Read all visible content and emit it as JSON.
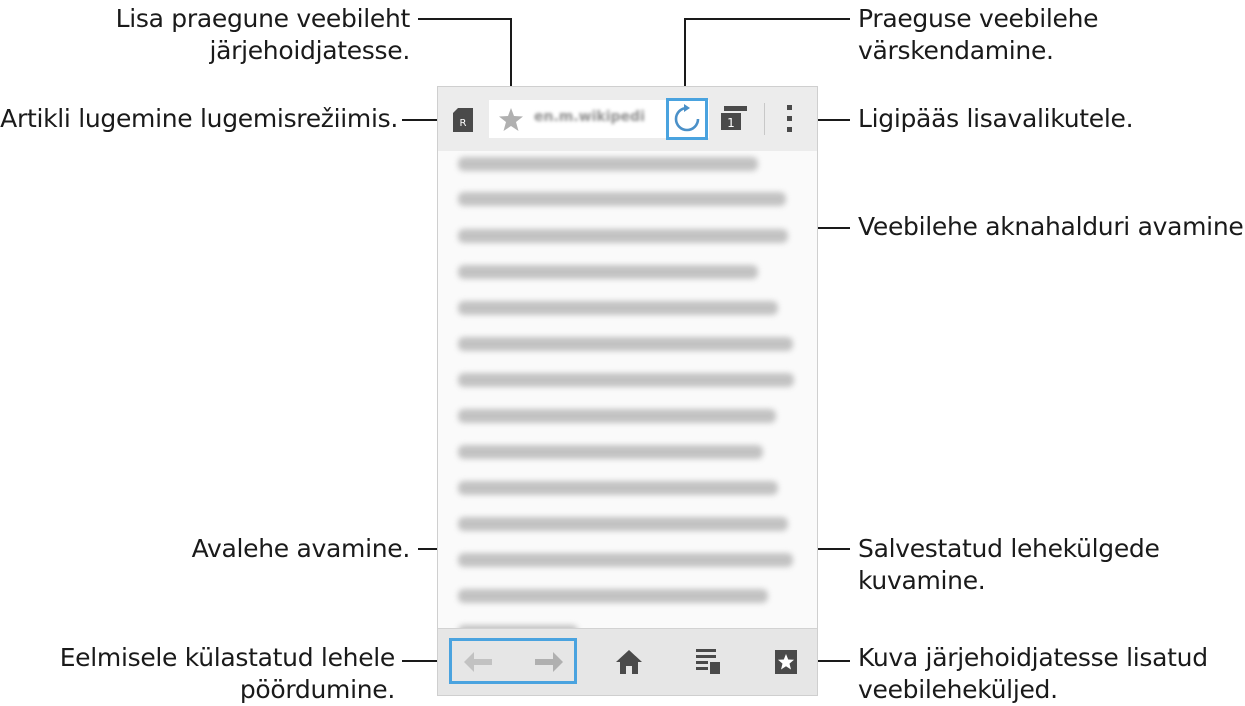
{
  "callouts": {
    "bookmark_add_line1": "Lisa praegune veebileht",
    "bookmark_add_line2": "järjehoidjatesse.",
    "reader_mode": "Artikli lugemine lugemisrežiimis.",
    "refresh_line1": "Praeguse veebilehe",
    "refresh_line2": "värskendamine.",
    "more_options": "Ligipääs lisavalikutele.",
    "window_manager": "Veebilehe aknahalduri avamine.",
    "home": "Avalehe avamine.",
    "saved_pages_line1": "Salvestatud lehekülgede",
    "saved_pages_line2": "kuvamine.",
    "back_forward_line1": "Eelmisele külastatud lehele",
    "back_forward_line2": "pöördumine.",
    "bookmarks_line1": "Kuva järjehoidjatesse lisatud",
    "bookmarks_line2": "veebileheküljed."
  },
  "browser": {
    "url": "en.m.wikipedi",
    "window_count": "1",
    "reader_badge": "R"
  },
  "icons": {
    "reader": "reader-mode-icon",
    "star": "star-icon",
    "refresh": "refresh-icon",
    "windows": "window-manager-icon",
    "more": "more-options-icon",
    "back": "arrow-left-icon",
    "forward": "arrow-right-icon",
    "home": "home-icon",
    "saved": "saved-pages-icon",
    "bookmarks": "bookmarks-icon"
  },
  "colors": {
    "highlight": "#4aa3df",
    "icon": "#555555"
  }
}
